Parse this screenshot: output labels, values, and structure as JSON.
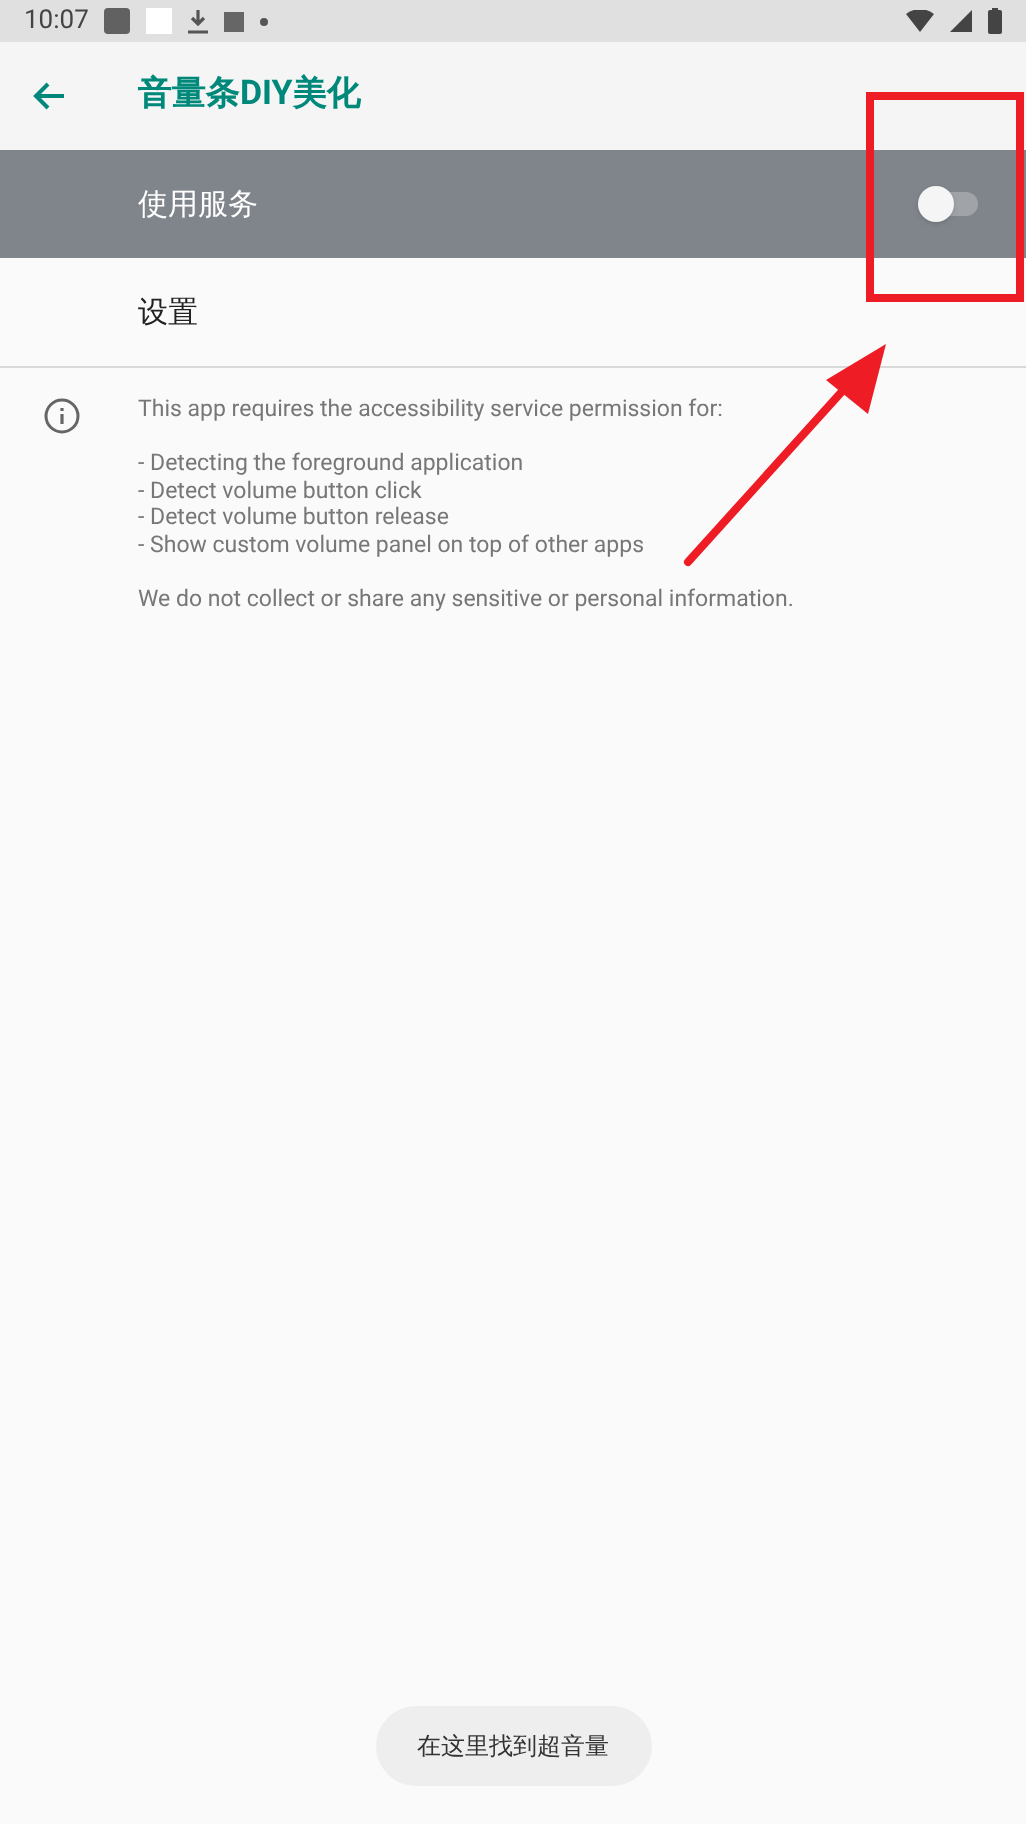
{
  "status_bar": {
    "time": "10:07"
  },
  "toolbar": {
    "title": "音量条DIY美化"
  },
  "settings": [
    {
      "kind": "switch",
      "label": "使用服务",
      "highlighted": true,
      "on": false
    },
    {
      "kind": "plain",
      "label": "设置",
      "highlighted": false
    }
  ],
  "info": {
    "intro": "This app requires the accessibility service permission for:",
    "items": [
      "- Detecting the foreground application",
      "- Detect volume button click",
      "- Detect volume button release",
      "- Show custom volume panel on top of other apps"
    ],
    "note": "We do not collect or share any sensitive or personal information."
  },
  "toast": "在这里找到超音量"
}
